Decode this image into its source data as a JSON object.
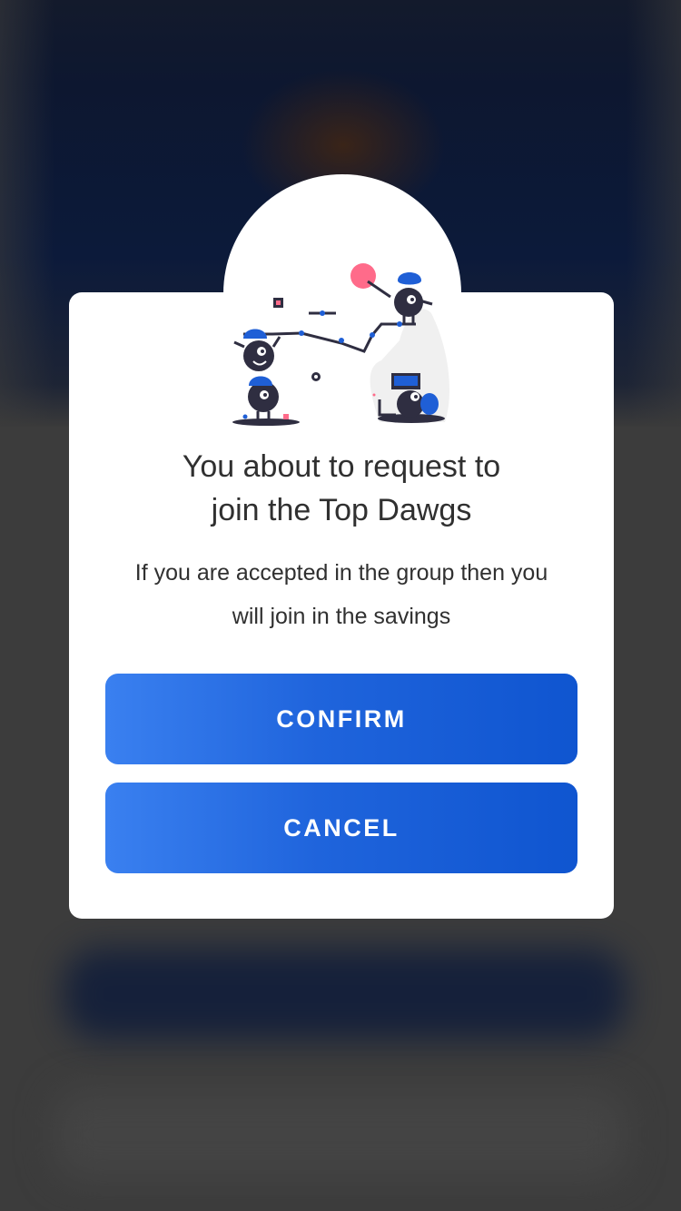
{
  "dialog": {
    "title_line1": "You about to request to",
    "title_line2": "join the Top Dawgs",
    "message_line1": "If you are accepted in the group then you",
    "message_line2": "will join in the savings",
    "confirm_label": "CONFIRM",
    "cancel_label": "CANCEL",
    "illustration_icon": "team-climbing-illustration"
  },
  "colors": {
    "button_start": "#3a80f0",
    "button_end": "#0f55d0",
    "modal_background": "#ffffff",
    "text": "#303030",
    "illustration_blue": "#1f5fd6",
    "illustration_dark": "#2f2e41",
    "illustration_pink": "#ff6b8a",
    "overlay": "#3c3c3c"
  }
}
